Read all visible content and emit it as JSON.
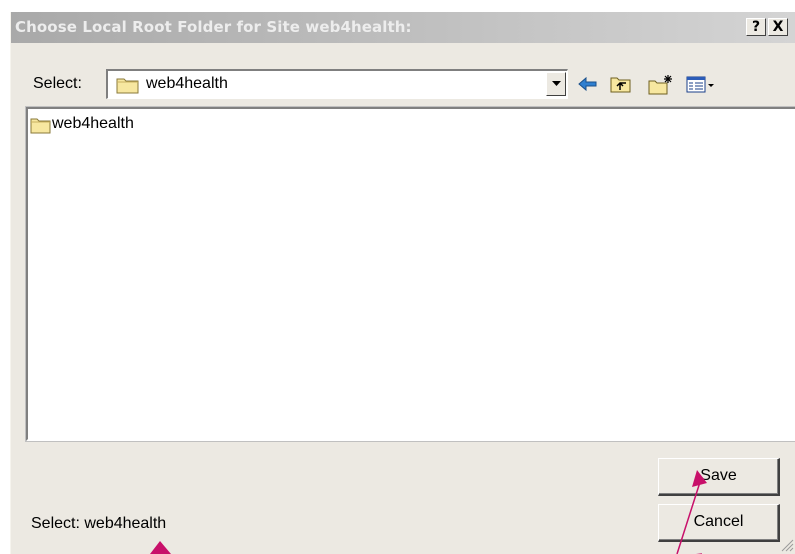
{
  "window": {
    "title": "Choose Local Root Folder for Site web4health:",
    "help_button": "?",
    "close_button": "X"
  },
  "toolbar": {
    "select_label": "Select:",
    "current_folder": "web4health",
    "icons": [
      "back-arrow-icon",
      "up-folder-icon",
      "new-folder-icon",
      "view-menu-icon"
    ]
  },
  "file_list": {
    "items": [
      {
        "name": "web4health",
        "icon": "folder-icon"
      }
    ]
  },
  "buttons": {
    "save": "Save",
    "cancel": "Cancel"
  },
  "status": {
    "selected_text": "Select: web4health"
  },
  "colors": {
    "dialog_bg": "#ece9e2",
    "annotation_arrow": "#c8106a",
    "folder_fill": "#f7e7a0"
  }
}
